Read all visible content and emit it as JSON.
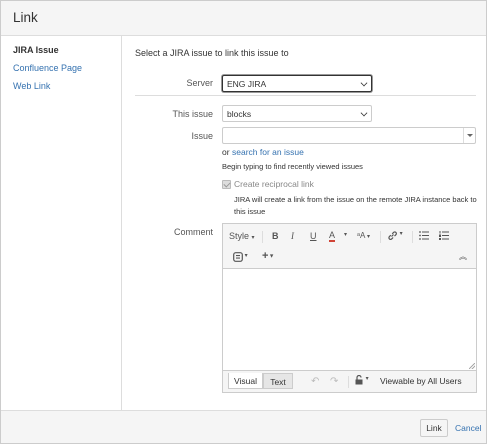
{
  "dialog": {
    "title": "Link"
  },
  "sidebar": {
    "items": [
      {
        "label": "JIRA Issue"
      },
      {
        "label": "Confluence Page"
      },
      {
        "label": "Web Link"
      }
    ]
  },
  "form": {
    "intro": "Select a JIRA issue to link this issue to",
    "server": {
      "label": "Server",
      "value": "ENG JIRA"
    },
    "this_issue": {
      "label": "This issue",
      "value": "blocks"
    },
    "issue": {
      "label": "Issue",
      "value": "",
      "or_text": "or",
      "search_link": "search for an issue",
      "hint": "Begin typing to find recently viewed issues"
    },
    "reciprocal": {
      "label": "Create reciprocal link",
      "checked": true,
      "description_line1": "JIRA will create a link from the issue on the remote JIRA instance back to",
      "description_line2": "this issue"
    },
    "comment": {
      "label": "Comment",
      "toolbar": {
        "style_label": "Style",
        "bold": "B",
        "italic": "I",
        "underline": "U",
        "color": "A",
        "more_format": "ᵃA",
        "link_icon": "link-icon",
        "bullet_list_icon": "bullet-list-icon",
        "numbered_list_icon": "numbered-list-icon",
        "emoticon_icon": "emoticon-icon",
        "insert_icon": "plus-icon",
        "collapse_icon": "collapse-icon"
      },
      "value": "",
      "tabs": [
        {
          "label": "Visual"
        },
        {
          "label": "Text"
        }
      ],
      "visibility": "Viewable by All Users"
    }
  },
  "footer": {
    "link_button": "Link",
    "cancel_link": "Cancel"
  },
  "colors": {
    "link": "#3572b0",
    "text_color_underline": "#d04437"
  }
}
